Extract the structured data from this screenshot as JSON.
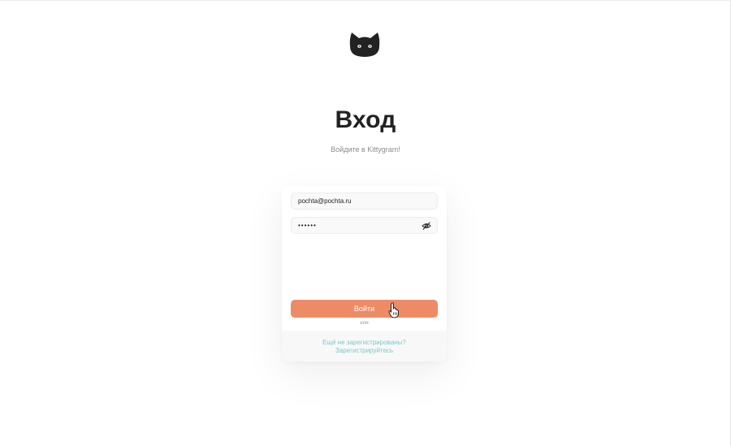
{
  "header": {
    "logo_icon": "cat-head-icon",
    "title": "Вход",
    "subtitle": "Войдите в Kittygram!"
  },
  "form": {
    "email_value": "pochta@pochta.ru",
    "password_value": "••••••",
    "password_toggle_icon": "eye-off-icon",
    "login_label": "Войти",
    "or_label": "или",
    "register_line1": "Ещё не зарегистрированы?",
    "register_line2": "Зарегистрируйтесь"
  },
  "cursor": {
    "icon": "hand-pointer-icon"
  },
  "colors": {
    "accent": "#ee8b67",
    "link": "#7ec6c6",
    "title": "#222222",
    "muted": "#8c8c8c"
  }
}
